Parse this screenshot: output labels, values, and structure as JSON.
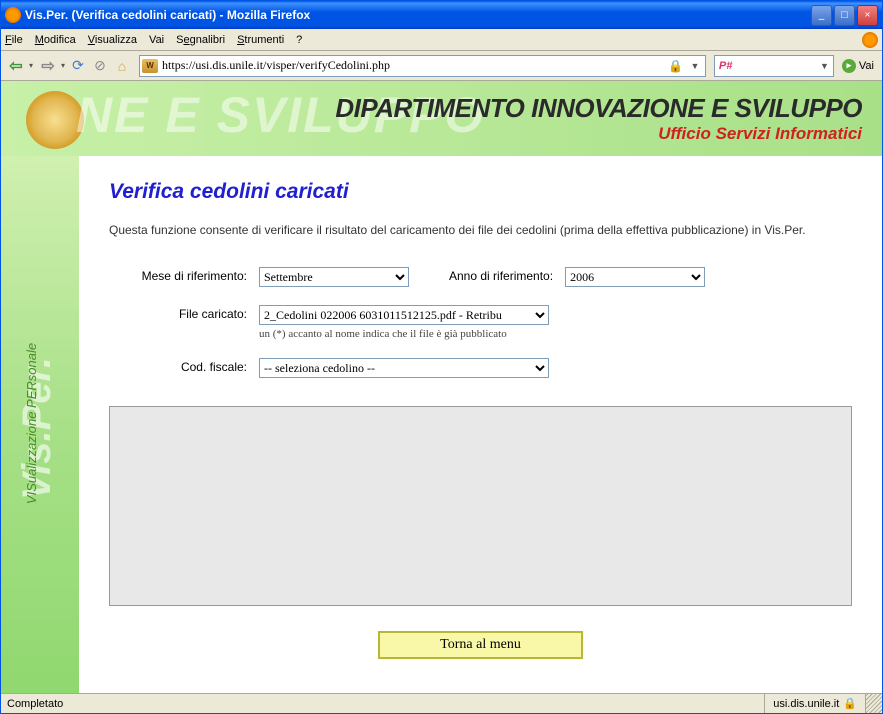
{
  "window": {
    "title": "Vis.Per. (Verifica cedolini caricati) - Mozilla Firefox"
  },
  "menubar": {
    "file": "File",
    "modifica": "Modifica",
    "visualizza": "Visualizza",
    "vai": "Vai",
    "segnalibri": "Segnalibri",
    "strumenti": "Strumenti",
    "help": "?"
  },
  "toolbar": {
    "url": "https://usi.dis.unile.it/visper/verifyCedolini.php",
    "go_label": "Vai",
    "search_placeholder": ""
  },
  "banner": {
    "watermark": "NE E SVILUPPO",
    "title": "DIPARTIMENTO INNOVAZIONE E SVILUPPO",
    "subtitle": "Ufficio Servizi Informatici"
  },
  "sidebar": {
    "brand": "Vis.Per.",
    "tagline": "VISualizzazione PERsonale"
  },
  "page": {
    "title": "Verifica cedolini caricati",
    "description": "Questa funzione consente di verificare il risultato del caricamento dei file dei cedolini (prima della effettiva pubblicazione) in Vis.Per.",
    "labels": {
      "mese": "Mese di riferimento:",
      "anno": "Anno di riferimento:",
      "file": "File caricato:",
      "cod": "Cod. fiscale:"
    },
    "values": {
      "mese": "Settembre",
      "anno": "2006",
      "file": "2_Cedolini 022006 6031011512125.pdf - Retribu",
      "cod": "-- seleziona cedolino --"
    },
    "file_hint": "un (*) accanto al nome indica che il file è già pubblicato",
    "back_button": "Torna al menu"
  },
  "statusbar": {
    "status": "Completato",
    "domain": "usi.dis.unile.it"
  }
}
